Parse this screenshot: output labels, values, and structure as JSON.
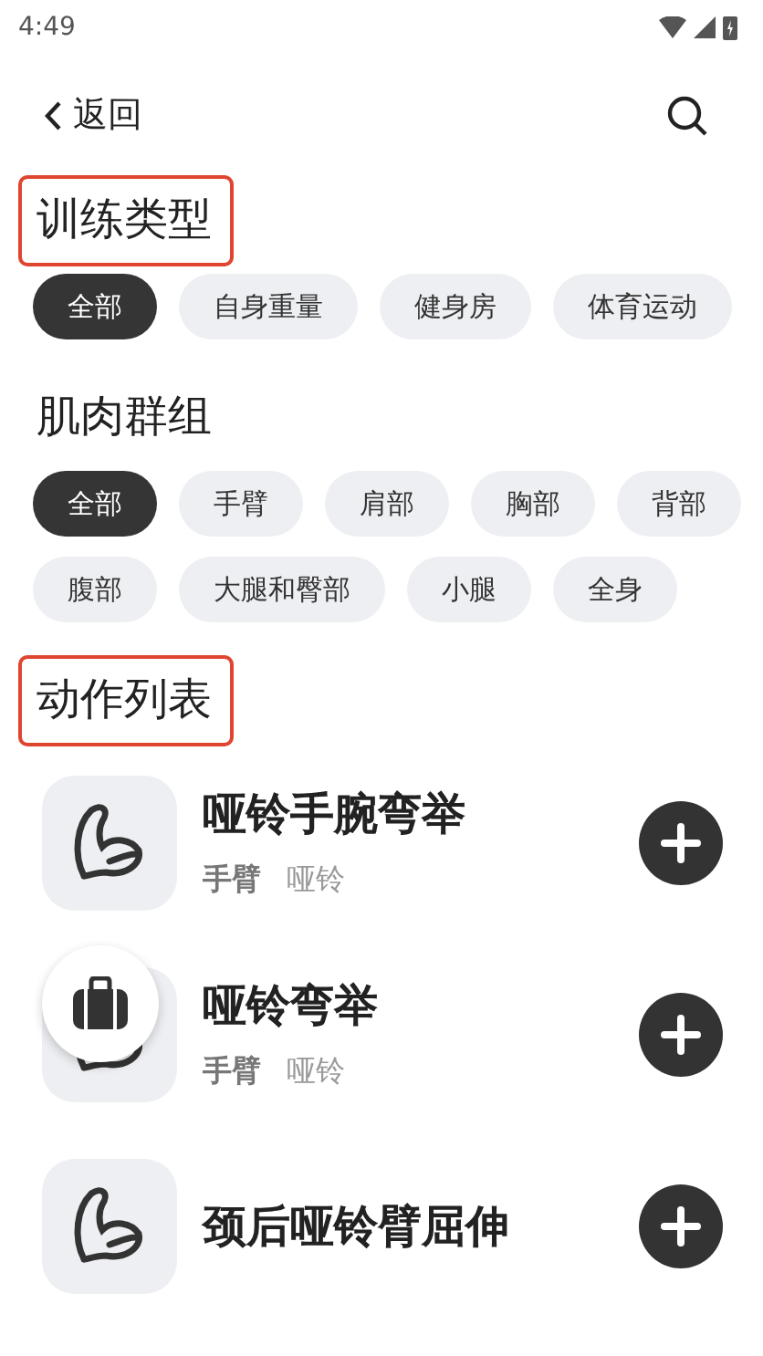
{
  "status_bar": {
    "time": "4:49"
  },
  "header": {
    "back_label": "返回"
  },
  "sections": [
    {
      "title": "训练类型",
      "highlighted": true,
      "chips": [
        {
          "label": "全部",
          "selected": true
        },
        {
          "label": "自身重量",
          "selected": false
        },
        {
          "label": "健身房",
          "selected": false
        },
        {
          "label": "体育运动",
          "selected": false
        }
      ]
    },
    {
      "title": "肌肉群组",
      "highlighted": false,
      "chips": [
        {
          "label": "全部",
          "selected": true
        },
        {
          "label": "手臂",
          "selected": false
        },
        {
          "label": "肩部",
          "selected": false
        },
        {
          "label": "胸部",
          "selected": false
        },
        {
          "label": "背部",
          "selected": false
        },
        {
          "label": "腹部",
          "selected": false
        },
        {
          "label": "大腿和臀部",
          "selected": false
        },
        {
          "label": "小腿",
          "selected": false
        },
        {
          "label": "全身",
          "selected": false
        }
      ]
    }
  ],
  "exercise_list": {
    "title": "动作列表",
    "highlighted": true,
    "items": [
      {
        "name": "哑铃手腕弯举",
        "tags": [
          "手臂",
          "哑铃"
        ]
      },
      {
        "name": "哑铃弯举",
        "tags": [
          "手臂",
          "哑铃"
        ],
        "overlay": true
      },
      {
        "name": "颈后哑铃臂屈伸"
      }
    ]
  }
}
